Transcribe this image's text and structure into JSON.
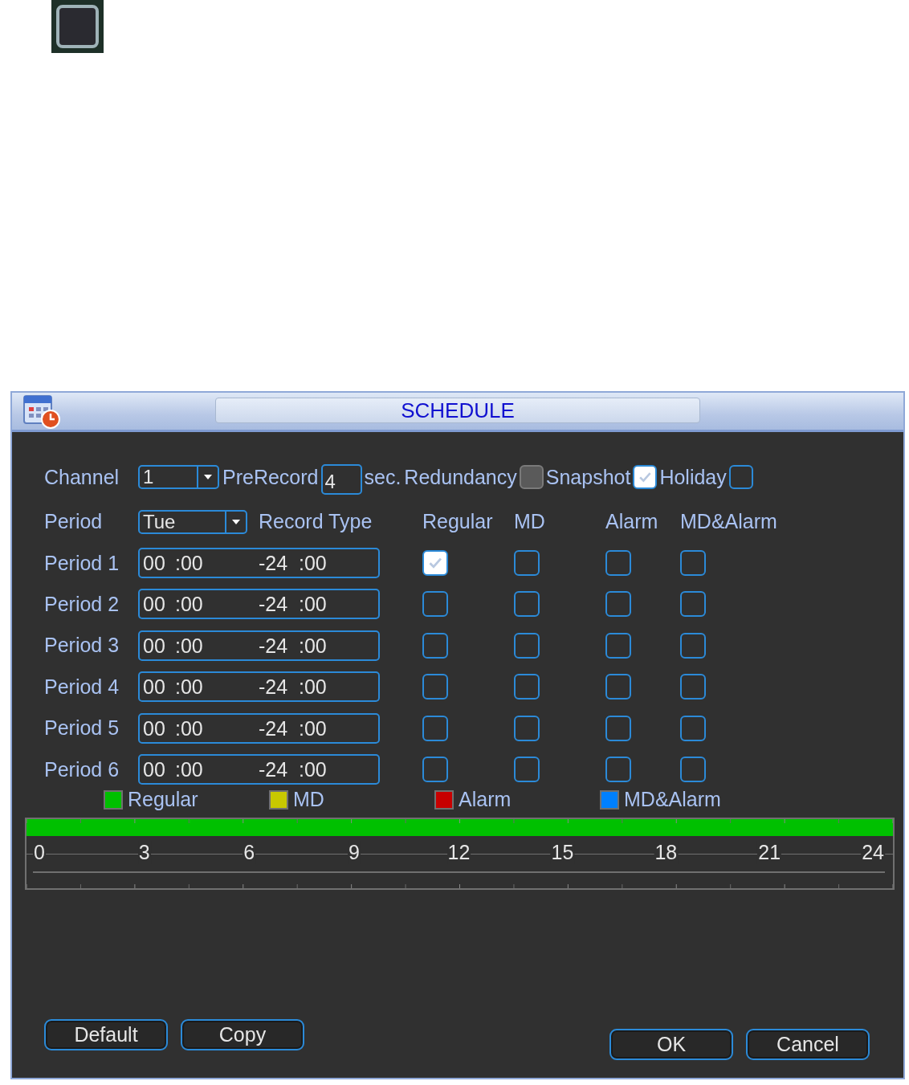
{
  "window": {
    "title": "SCHEDULE"
  },
  "channel": {
    "label": "Channel",
    "value": "1"
  },
  "prerecord": {
    "label": "PreRecord",
    "value": "4",
    "unit": "sec."
  },
  "options": [
    {
      "label": "Redundancy",
      "checked": false,
      "disabled": true
    },
    {
      "label": "Snapshot",
      "checked": true,
      "disabled": false
    },
    {
      "label": "Holiday",
      "checked": false,
      "disabled": false
    }
  ],
  "period": {
    "label": "Period",
    "value": "Tue"
  },
  "record_type": {
    "label": "Record Type",
    "columns": [
      "Regular",
      "MD",
      "Alarm",
      "MD&Alarm"
    ]
  },
  "periods": [
    {
      "label": "Period 1",
      "start_hour": "00",
      "start_minute": ":00",
      "end_hour": "-24",
      "end_minute": ":00",
      "types": [
        {
          "checked": true
        },
        {
          "checked": false
        },
        {
          "checked": false
        },
        {
          "checked": false
        }
      ]
    },
    {
      "label": "Period 2",
      "start_hour": "00",
      "start_minute": ":00",
      "end_hour": "-24",
      "end_minute": ":00",
      "types": [
        {
          "checked": false
        },
        {
          "checked": false
        },
        {
          "checked": false
        },
        {
          "checked": false
        }
      ]
    },
    {
      "label": "Period 3",
      "start_hour": "00",
      "start_minute": ":00",
      "end_hour": "-24",
      "end_minute": ":00",
      "types": [
        {
          "checked": false
        },
        {
          "checked": false
        },
        {
          "checked": false
        },
        {
          "checked": false
        }
      ]
    },
    {
      "label": "Period 4",
      "start_hour": "00",
      "start_minute": ":00",
      "end_hour": "-24",
      "end_minute": ":00",
      "types": [
        {
          "checked": false
        },
        {
          "checked": false
        },
        {
          "checked": false
        },
        {
          "checked": false
        }
      ]
    },
    {
      "label": "Period 5",
      "start_hour": "00",
      "start_minute": ":00",
      "end_hour": "-24",
      "end_minute": ":00",
      "types": [
        {
          "checked": false
        },
        {
          "checked": false
        },
        {
          "checked": false
        },
        {
          "checked": false
        }
      ]
    },
    {
      "label": "Period 6",
      "start_hour": "00",
      "start_minute": ":00",
      "end_hour": "-24",
      "end_minute": ":00",
      "types": [
        {
          "checked": false
        },
        {
          "checked": false
        },
        {
          "checked": false
        },
        {
          "checked": false
        }
      ]
    }
  ],
  "legend": [
    {
      "label": "Regular",
      "color": "#00c000"
    },
    {
      "label": "MD",
      "color": "#c8c800"
    },
    {
      "label": "Alarm",
      "color": "#c80000"
    },
    {
      "label": "MD&Alarm",
      "color": "#0080ff"
    }
  ],
  "timeline": {
    "level": 1,
    "color": "#00c000",
    "ticks": [
      "0",
      "3",
      "6",
      "9",
      "12",
      "15",
      "18",
      "21",
      "24"
    ]
  },
  "left_buttons": [
    "Default",
    "Copy"
  ],
  "right_buttons": [
    "OK",
    "Cancel"
  ]
}
